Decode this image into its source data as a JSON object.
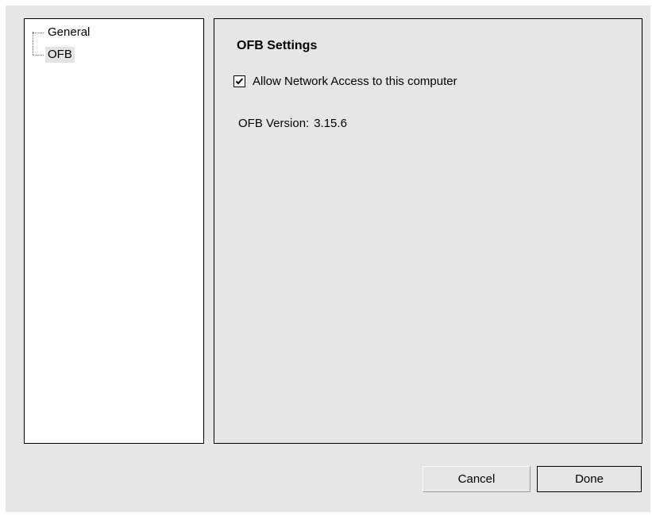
{
  "tree": {
    "items": [
      {
        "label": "General",
        "selected": false
      },
      {
        "label": "OFB",
        "selected": true
      }
    ]
  },
  "settings": {
    "title": "OFB Settings",
    "allow_network_label": "Allow Network Access to this computer",
    "allow_network_checked": true,
    "version_label": "OFB Version:",
    "version_value": "3.15.6"
  },
  "buttons": {
    "cancel": "Cancel",
    "done": "Done"
  },
  "colors": {
    "dialog_background": "#e6e6e6",
    "tree_background": "#ffffff",
    "selection_highlight": "#e3e3e3"
  },
  "icons": {
    "checkbox_mark": "check-icon"
  }
}
